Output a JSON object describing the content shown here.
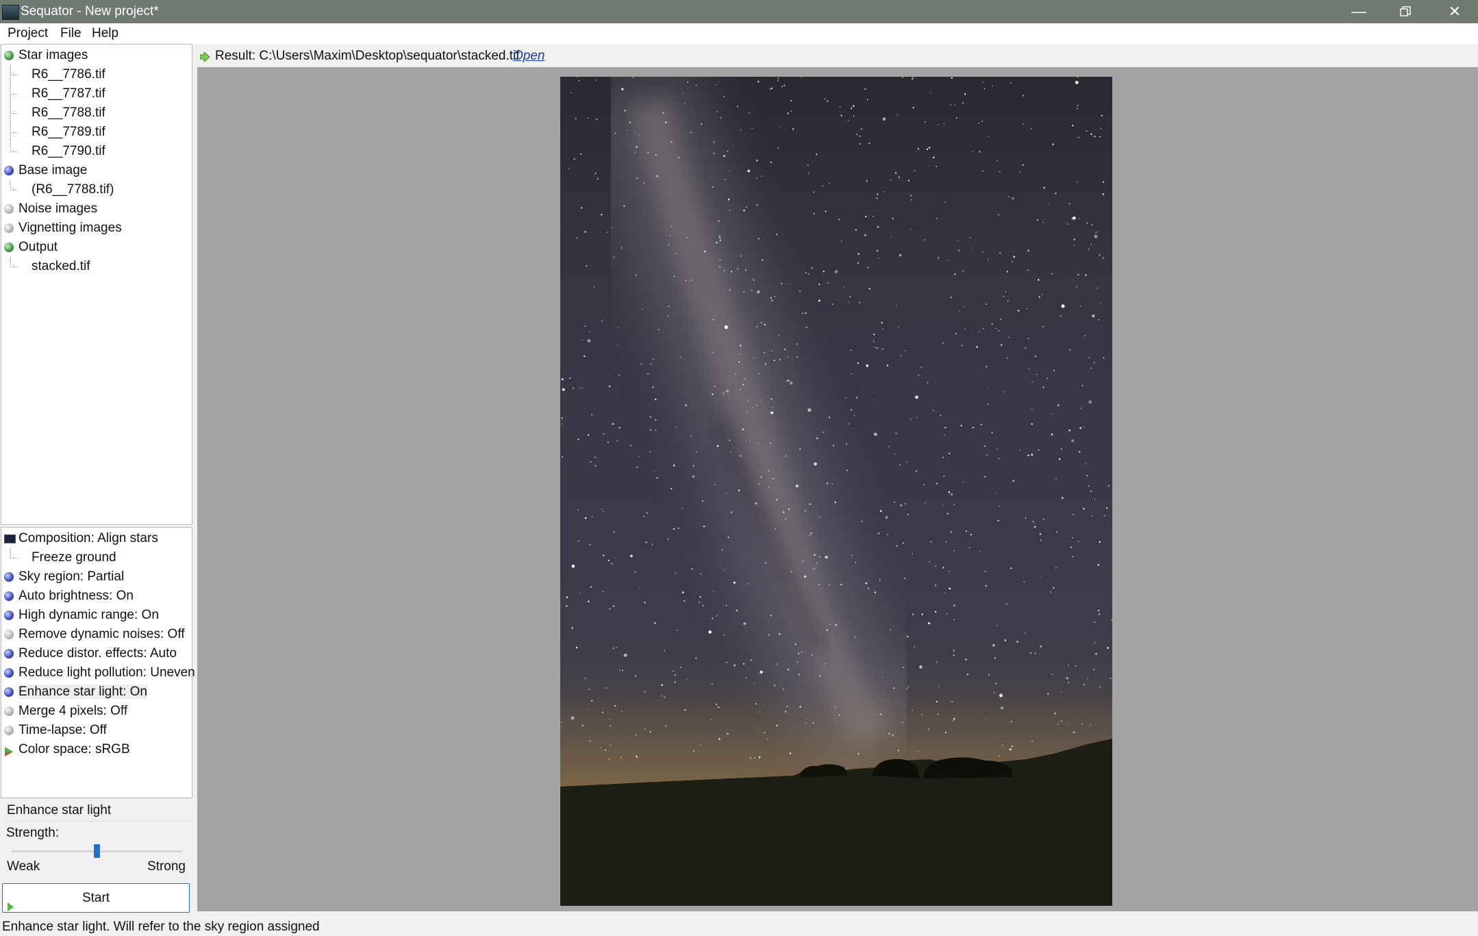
{
  "window": {
    "title": "Sequator - New project*"
  },
  "menu": [
    "Project",
    "File",
    "Help"
  ],
  "inputs_tree": {
    "star_images": {
      "label": "Star images",
      "files": [
        "R6__7786.tif",
        "R6__7787.tif",
        "R6__7788.tif",
        "R6__7789.tif",
        "R6__7790.tif"
      ]
    },
    "base_image": {
      "label": "Base image",
      "file": "(R6__7788.tif)"
    },
    "noise_images": {
      "label": "Noise images"
    },
    "vignetting_images": {
      "label": "Vignetting images"
    },
    "output": {
      "label": "Output",
      "file": "stacked.tif"
    }
  },
  "settings": {
    "composition": "Composition: Align stars",
    "freeze_ground": "Freeze ground",
    "sky_region": "Sky region: Partial",
    "auto_brightness": "Auto brightness: On",
    "hdr": "High dynamic range: On",
    "remove_noises": "Remove dynamic noises: Off",
    "reduce_distortion": "Reduce distor. effects: Auto",
    "reduce_light_pollution": "Reduce light pollution: Uneven",
    "enhance_star_light": "Enhance star light: On",
    "merge_pixels": "Merge 4 pixels: Off",
    "time_lapse": "Time-lapse: Off",
    "color_space": "Color space: sRGB"
  },
  "detail_panel": {
    "title": "Enhance star light",
    "strength_label": "Strength:",
    "weak_label": "Weak",
    "strong_label": "Strong",
    "strength_value": 0.5
  },
  "start_button": "Start",
  "result": {
    "label": "Result: C:\\Users\\Maxim\\Desktop\\sequator\\stacked.tif",
    "open_link": "Open"
  },
  "status_text": "Enhance star light. Will refer to the sky region assigned",
  "colors": {
    "titlebar": "#6f7a73",
    "viewer_bg": "#a3a3a3",
    "link": "#1a3fb0",
    "slider_thumb": "#1f6fd0"
  }
}
